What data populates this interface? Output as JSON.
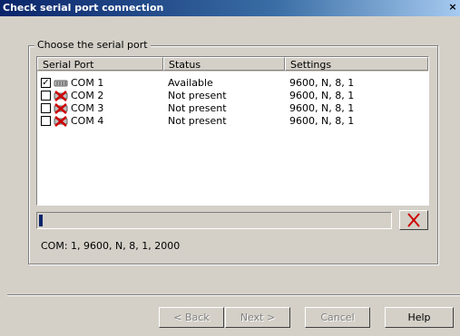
{
  "window": {
    "title": "Check serial port connection",
    "close_glyph": "×"
  },
  "group": {
    "legend": "Choose the serial port"
  },
  "table": {
    "columns": [
      "Serial Port",
      "Status",
      "Settings"
    ],
    "rows": [
      {
        "checked": true,
        "icon": "serial-port-icon",
        "port": "COM 1",
        "status": "Available",
        "settings": "9600, N, 8, 1"
      },
      {
        "checked": false,
        "icon": "port-not-present-icon",
        "port": "COM 2",
        "status": "Not present",
        "settings": "9600, N, 8, 1"
      },
      {
        "checked": false,
        "icon": "port-not-present-icon",
        "port": "COM 3",
        "status": "Not present",
        "settings": "9600, N, 8, 1"
      },
      {
        "checked": false,
        "icon": "port-not-present-icon",
        "port": "COM 4",
        "status": "Not present",
        "settings": "9600, N, 8, 1"
      }
    ]
  },
  "progress": {
    "fraction": 0.01,
    "fill_color": "#0a246a"
  },
  "abort_icon": "red-x-icon",
  "status_line": "COM: 1, 9600, N, 8, 1, 2000",
  "buttons": {
    "back": "< Back",
    "next": "Next >",
    "cancel": "Cancel",
    "help": "Help"
  },
  "colors": {
    "title_bar": "#0a246a",
    "dialog_bg": "#d4d0c8",
    "error_red": "#cc0000"
  }
}
